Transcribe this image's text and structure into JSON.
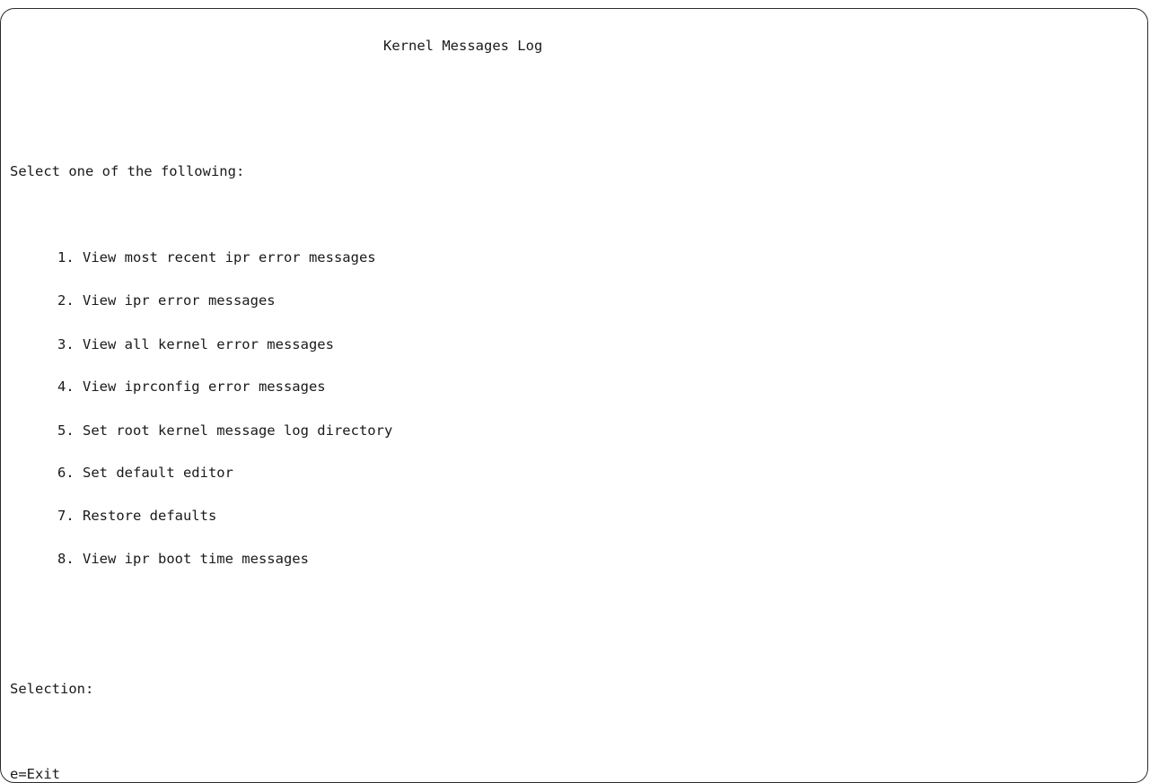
{
  "screen": {
    "title": "Kernel Messages Log",
    "prompt": "Select one of the following:",
    "menu": [
      {
        "label": "1. View most recent ipr error messages"
      },
      {
        "label": "2. View ipr error messages"
      },
      {
        "label": "3. View all kernel error messages"
      },
      {
        "label": "4. View iprconfig error messages"
      },
      {
        "label": "5. Set root kernel message log directory"
      },
      {
        "label": "6. Set default editor"
      },
      {
        "label": "7. Restore defaults"
      },
      {
        "label": "8. View ipr boot time messages"
      }
    ],
    "selection_label": "Selection:",
    "selection_value": "",
    "function_keys": "e=Exit"
  }
}
